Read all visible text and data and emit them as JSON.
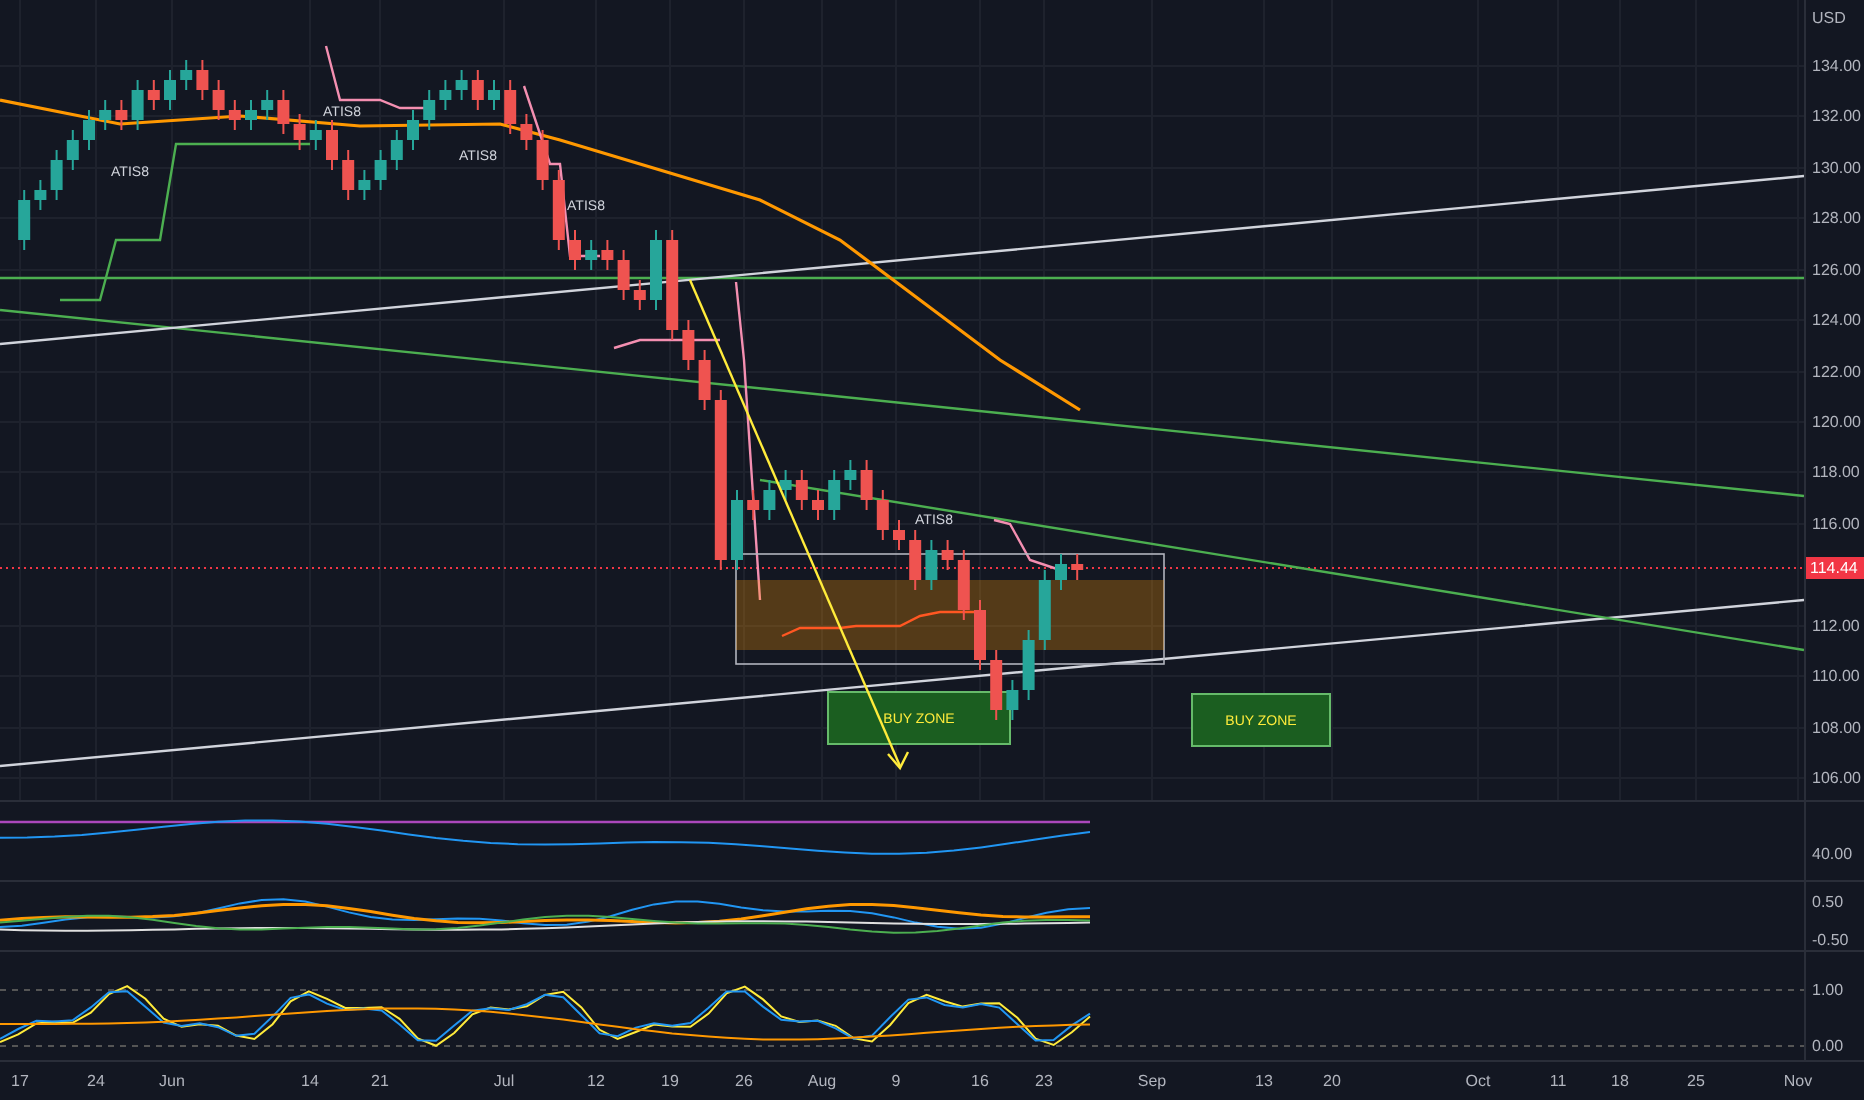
{
  "price_axis": {
    "currency": "USD",
    "labels": [
      "134.00",
      "132.00",
      "130.00",
      "128.00",
      "126.00",
      "124.00",
      "122.00",
      "120.00",
      "118.00",
      "116.00",
      "112.00",
      "110.00",
      "108.00",
      "106.00"
    ],
    "last_price": "114.44"
  },
  "chart": {
    "signal_labels": [
      "ATIS8",
      "ATIS8",
      "ATIS8",
      "ATIS8",
      "ATIS8"
    ],
    "zones": [
      {
        "label": "BUY ZONE"
      },
      {
        "label": "BUY ZONE"
      }
    ]
  },
  "panes": [
    {
      "labels": [
        "40.00"
      ]
    },
    {
      "labels": [
        "0.50",
        "-0.50"
      ]
    },
    {
      "labels": [
        "1.00",
        "0.00"
      ]
    }
  ],
  "time_axis": [
    "17",
    "24",
    "Jun",
    "14",
    "21",
    "Jul",
    "12",
    "19",
    "26",
    "Aug",
    "9",
    "16",
    "23",
    "Sep",
    "13",
    "20",
    "Oct",
    "11",
    "18",
    "25",
    "Nov"
  ]
}
